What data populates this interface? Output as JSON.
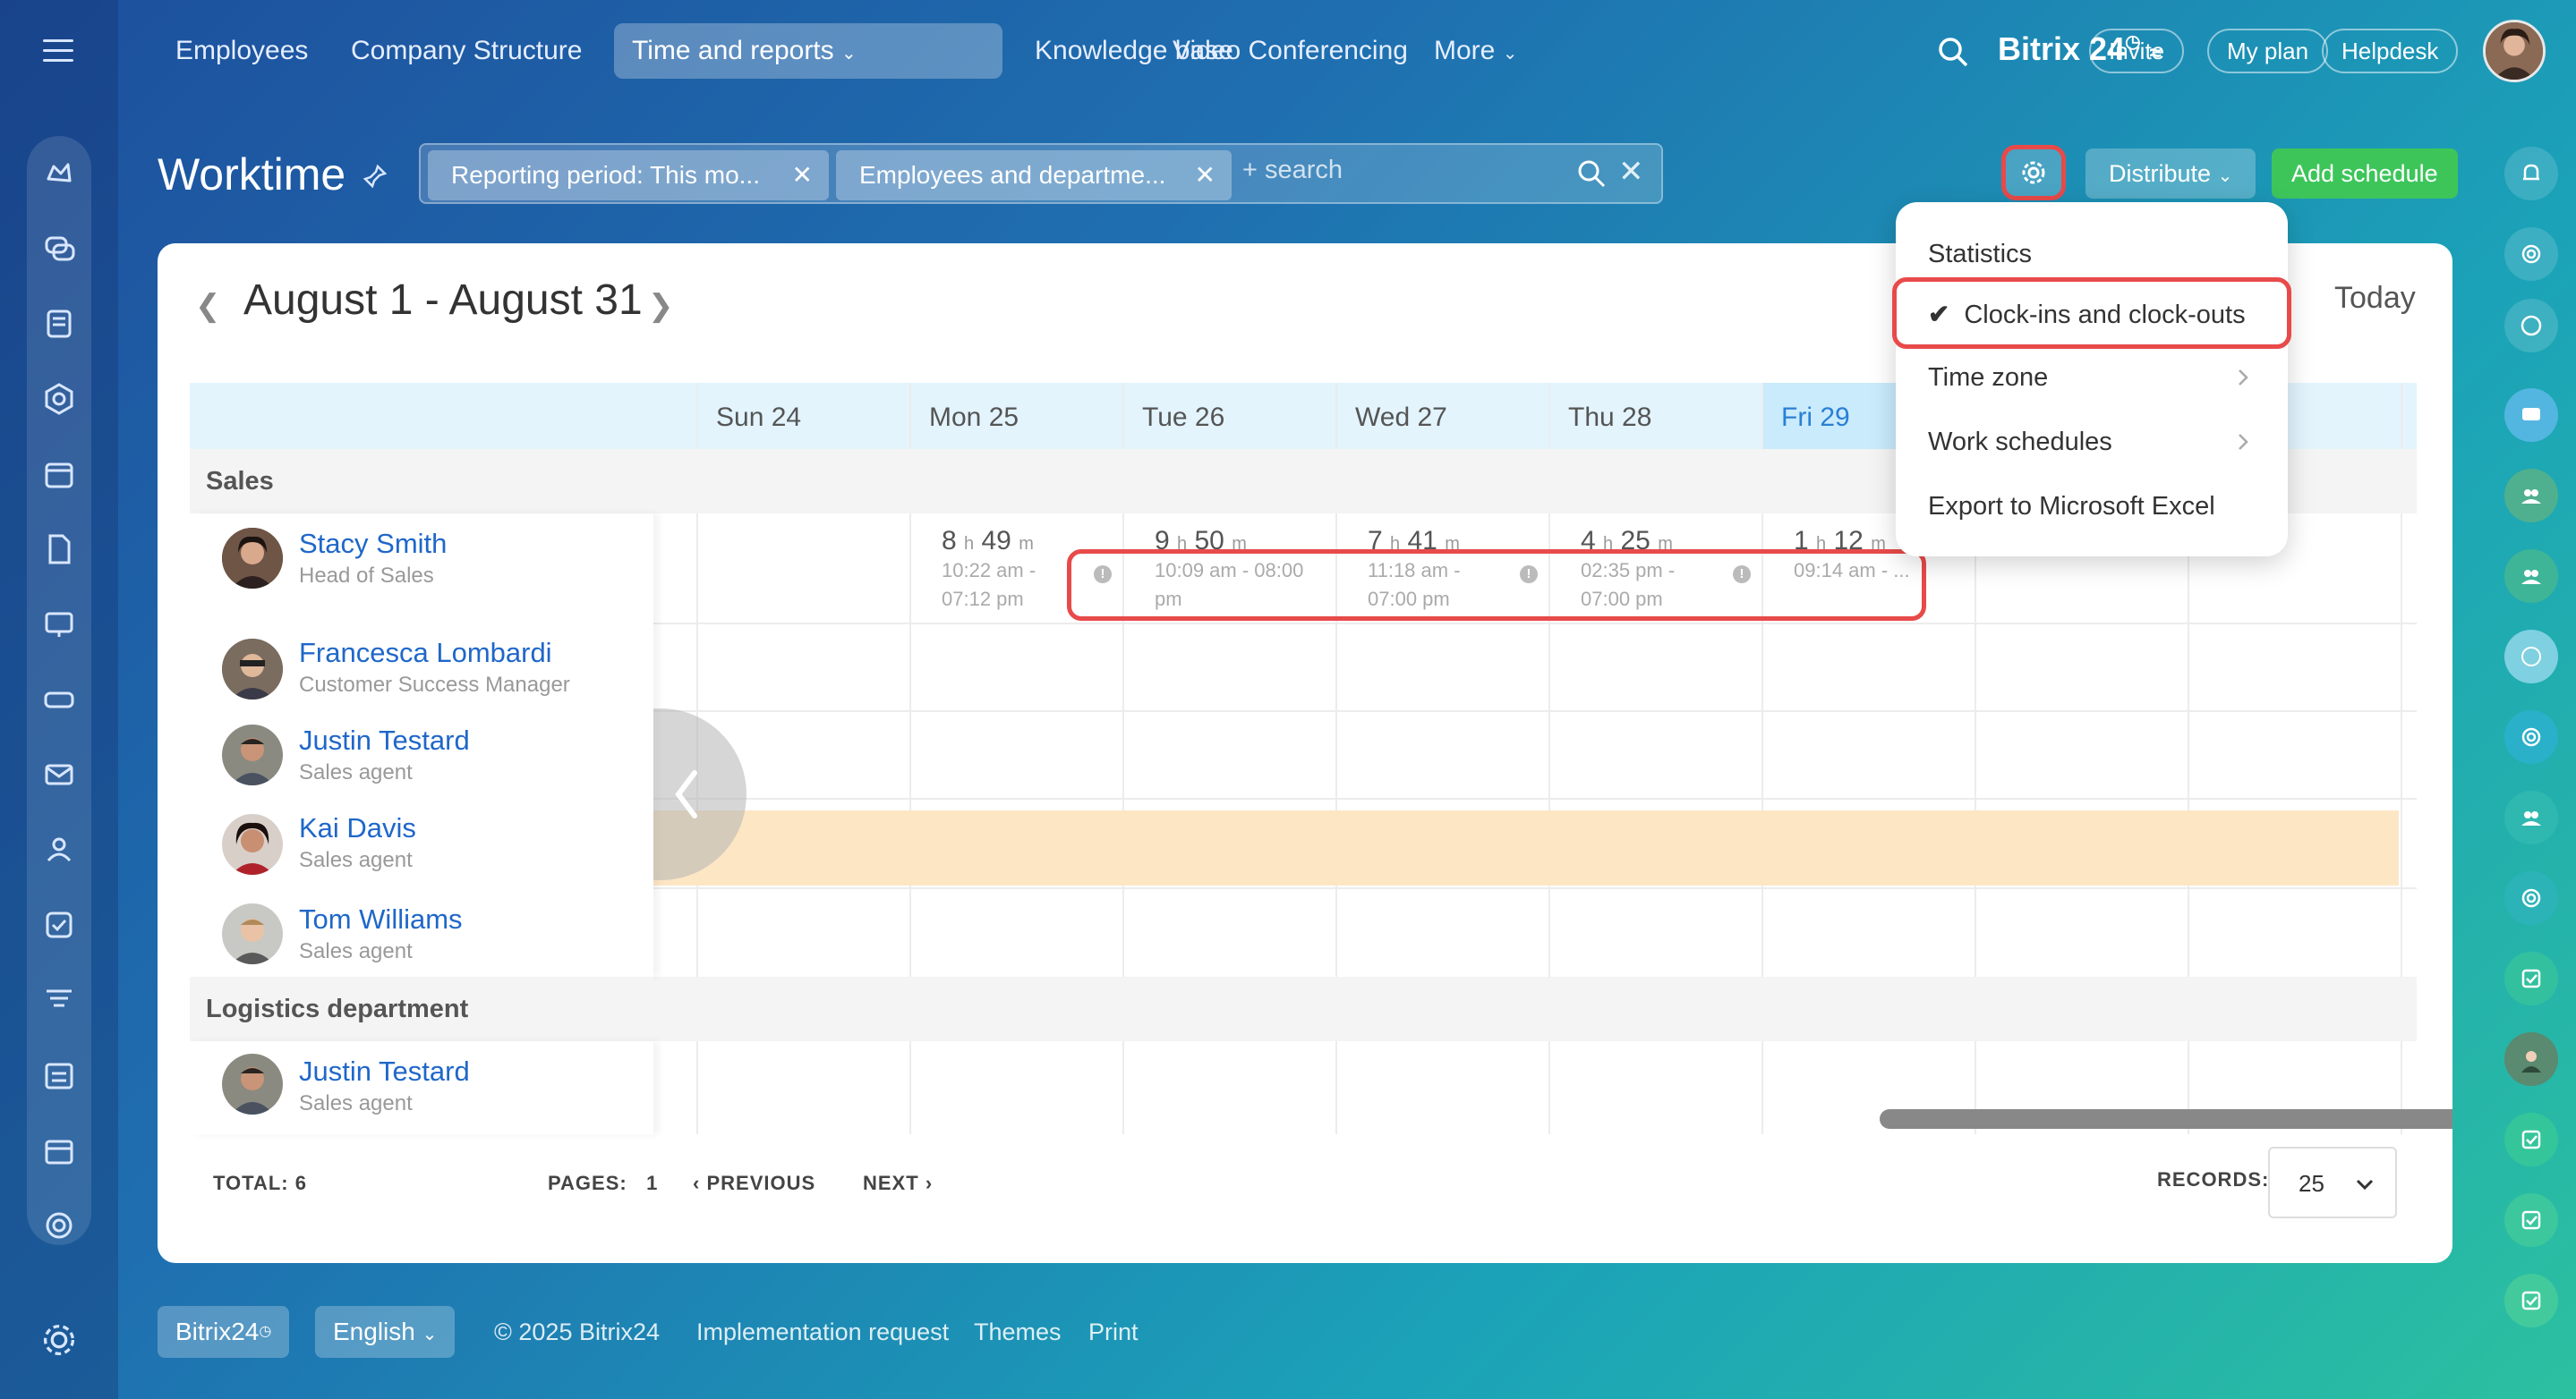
{
  "topnav": {
    "items": [
      "Employees",
      "Company Structure",
      "Time and reports",
      "Knowledge base",
      "Video Conferencing",
      "More"
    ],
    "active_index": 2
  },
  "header": {
    "logo": "Bitrix 24",
    "invite": "Invite",
    "my_plan": "My plan",
    "helpdesk": "Helpdesk"
  },
  "page": {
    "title": "Worktime",
    "filter_chips": [
      "Reporting period: This mo...",
      "Employees and departme..."
    ],
    "search_placeholder": "+ search",
    "distribute": "Distribute",
    "add_schedule": "Add schedule"
  },
  "calendar": {
    "period": "August 1 - August 31",
    "today": "Today",
    "days": [
      "Sun 24",
      "Mon 25",
      "Tue 26",
      "Wed 27",
      "Thu 28",
      "Fri 29"
    ],
    "sections": [
      {
        "name": "Sales",
        "employees": [
          {
            "name": "Stacy Smith",
            "role": "Head of Sales"
          },
          {
            "name": "Francesca Lombardi",
            "role": "Customer Success Manager"
          },
          {
            "name": "Justin Testard",
            "role": "Sales agent"
          },
          {
            "name": "Kai Davis",
            "role": "Sales agent"
          },
          {
            "name": "Tom Williams",
            "role": "Sales agent"
          }
        ]
      },
      {
        "name": "Logistics department",
        "employees": [
          {
            "name": "Justin Testard",
            "role": "Sales agent"
          }
        ]
      }
    ],
    "stacy_cells": [
      {
        "h": "8",
        "m": "49",
        "t1": "10:22 am -",
        "t2": "07:12 pm"
      },
      {
        "h": "9",
        "m": "50",
        "t1": "10:09 am - 08:00",
        "t2": "pm"
      },
      {
        "h": "7",
        "m": "41",
        "t1": "11:18 am -",
        "t2": "07:00 pm"
      },
      {
        "h": "4",
        "m": "25",
        "t1": "02:35 pm -",
        "t2": "07:00 pm"
      },
      {
        "h": "1",
        "m": "12",
        "t1": "09:14 am - ...",
        "t2": ""
      }
    ],
    "unit_h": "h",
    "unit_m": "m"
  },
  "pager": {
    "total_label": "TOTAL:",
    "total_value": "6",
    "pages_label": "PAGES:",
    "pages_value": "1",
    "previous": "PREVIOUS",
    "next": "NEXT",
    "records_label": "RECORDS:",
    "records_value": "25"
  },
  "menu": {
    "items": [
      "Statistics",
      "Clock-ins and clock-outs",
      "Time zone",
      "Work schedules",
      "Export to Microsoft Excel"
    ],
    "checked_index": 1
  },
  "footer": {
    "brand": "Bitrix24",
    "language": "English",
    "copyright": "© 2025 Bitrix24",
    "implementation": "Implementation request",
    "themes": "Themes",
    "print": "Print"
  },
  "colors": {
    "accent": "#2a7fd4",
    "highlight": "#e84a4a",
    "success": "#3dc55a",
    "vacation": "#fde6c4"
  }
}
